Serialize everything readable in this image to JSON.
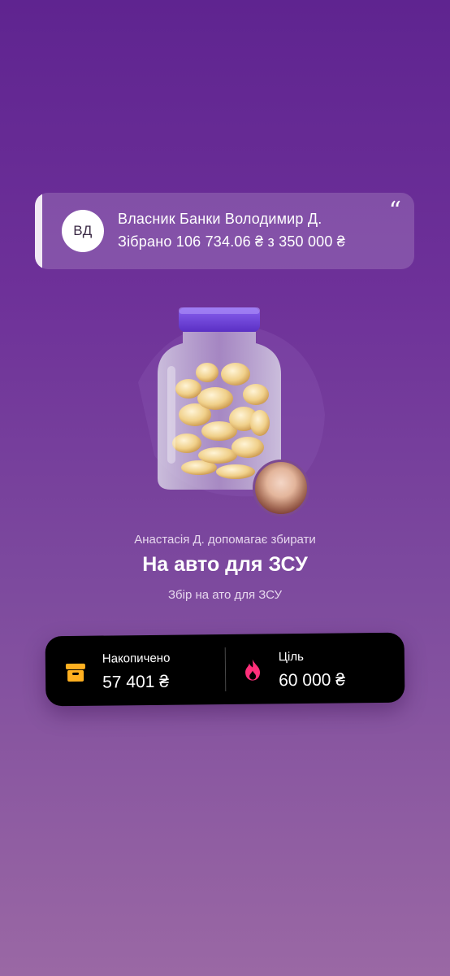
{
  "owner": {
    "initials": "ВД",
    "name": "Власник Банки Володимир Д.",
    "collected_text": "Зібрано 106 734.06 ₴ з 350 000 ₴",
    "quote_glyph": "“"
  },
  "jar": {
    "helper_text": "Анастасія Д. допомагає збирати",
    "title": "На авто для ЗСУ",
    "description": "Збір на ато для ЗСУ"
  },
  "stats": {
    "accumulated_label": "Накопичено",
    "accumulated_value": "57 401 ₴",
    "goal_label": "Ціль",
    "goal_value": "60 000 ₴"
  },
  "colors": {
    "accent_orange": "#ffb020",
    "accent_pink": "#ff2f7a",
    "lid_purple": "#6b3fd6"
  },
  "icons": {
    "accumulated": "box-icon",
    "goal": "flame-icon",
    "quote": "quote-icon"
  }
}
